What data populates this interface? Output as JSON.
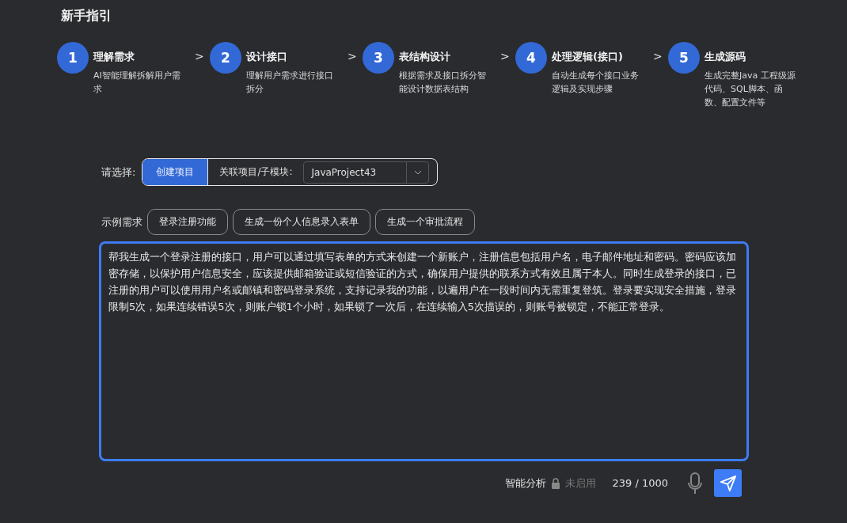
{
  "title": "新手指引",
  "steps": [
    {
      "number": "1",
      "title": "理解需求",
      "description": "AI智能理解拆解用户需求"
    },
    {
      "number": "2",
      "title": "设计接口",
      "description": "理解用户需求进行接口拆分"
    },
    {
      "number": "3",
      "title": "表结构设计",
      "description": "根据需求及接口拆分智能设计数据表结构"
    },
    {
      "number": "4",
      "title": "处理逻辑(接口)",
      "description": "自动生成每个接口业务逻辑及实现步骤"
    },
    {
      "number": "5",
      "title": "生成源码",
      "description": "生成完整Java 工程级源代码、SQL脚本、函数、配置文件等"
    }
  ],
  "step_separator": ">",
  "mode": {
    "label": "请选择:",
    "options": [
      {
        "label": "创建项目",
        "selected": true
      },
      {
        "label": "关联项目/子模块:",
        "selected": false
      }
    ],
    "project_select": {
      "value": "JavaProject43"
    }
  },
  "examples": {
    "label": "示例需求",
    "items": [
      "登录注册功能",
      "生成一份个人信息录入表单",
      "生成一个审批流程"
    ]
  },
  "prompt": {
    "value": "帮我生成一个登录注册的接口，用户可以通过填写表单的方式来创建一个新账户，注册信息包括用户名，电子邮件地址和密码。密码应该加密存储，以保护用户信息安全，应该提供邮箱验证或短信验证的方式，确保用户提供的联系方式有效且属于本人。同时生成登录的接口，已注册的用户可以使用用户名或邮镇和密码登录系统，支持记录我的功能，以遍用户在一段时间内无需重复登筑。登录要实现安全措施，登录限制5次，如果连续错误5次，则账户锁1个小时，如果锁了一次后，在连续输入5次描误的，则账号被锁定，不能正常登录。",
    "focused": true
  },
  "footer": {
    "analysis_label": "智能分析",
    "analysis_status": "未启用",
    "analysis_enabled": false,
    "counter": "239 / 1000"
  }
}
